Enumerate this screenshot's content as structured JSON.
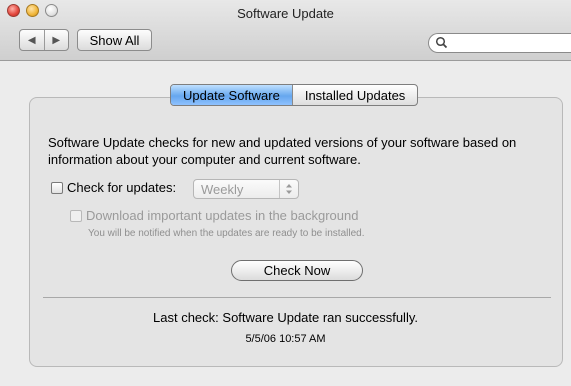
{
  "window": {
    "title": "Software Update"
  },
  "toolbar": {
    "back_icon": "chevron-left-icon",
    "forward_icon": "chevron-right-icon",
    "show_all_label": "Show All",
    "search_placeholder": "",
    "search_icon": "search-icon"
  },
  "tabs": [
    {
      "label": "Update Software",
      "active": true
    },
    {
      "label": "Installed Updates",
      "active": false
    }
  ],
  "description": "Software Update checks for new and updated versions of your software based on information about your computer and current software.",
  "check_for_updates": {
    "label": "Check for updates:",
    "checked": false,
    "frequency": "Weekly"
  },
  "download_background": {
    "label": "Download important updates in the background",
    "checked": false,
    "enabled": false,
    "note": "You will be notified when the updates are ready to be installed."
  },
  "check_now_label": "Check Now",
  "status": {
    "label": "Last check:",
    "message": "Software Update ran successfully.",
    "timestamp": "5/5/06 10:57 AM"
  },
  "colors": {
    "active_tab": "#66a7ee",
    "close": "#e2463c",
    "minimize": "#f0b63a",
    "zoom": "#c4c4c4"
  }
}
